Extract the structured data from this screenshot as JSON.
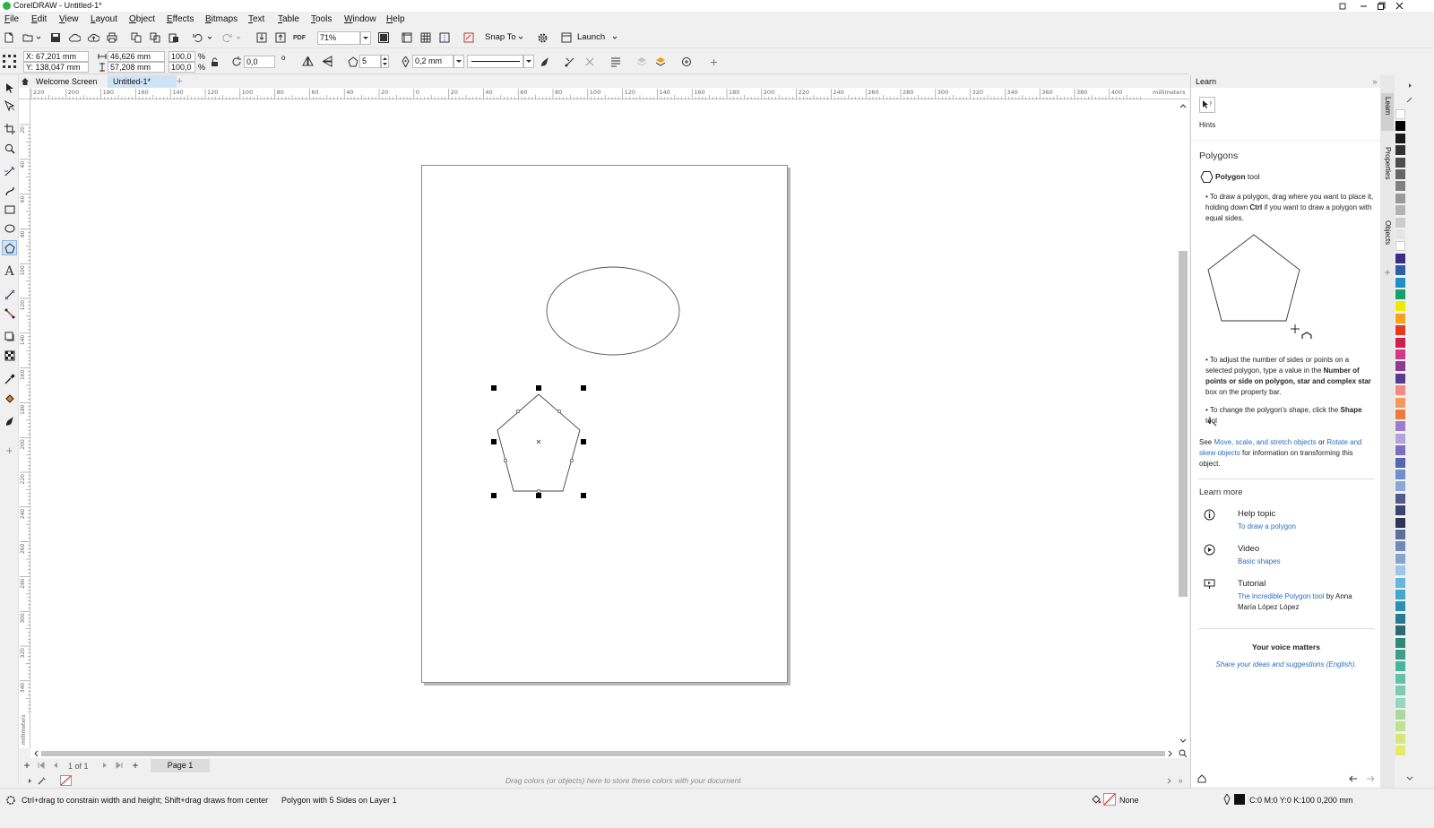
{
  "window": {
    "title": "CorelDRAW - Untitled-1*"
  },
  "menu": [
    "File",
    "Edit",
    "View",
    "Layout",
    "Object",
    "Effects",
    "Bitmaps",
    "Text",
    "Table",
    "Tools",
    "Window",
    "Help"
  ],
  "toolbar": {
    "zoom": "71%",
    "snap_to": "Snap To",
    "launch": "Launch"
  },
  "property_bar": {
    "x": "X: 67,201 mm",
    "y": "Y: 138,047 mm",
    "width": "46,626 mm",
    "height": "57,208 mm",
    "scale_x": "100,0",
    "scale_y": "100,0",
    "percent": "%",
    "rotation": "0,0",
    "degree": "o",
    "sides": "5",
    "outline_width": "0,2 mm"
  },
  "tabs": {
    "welcome": "Welcome Screen",
    "doc": "Untitled-1*",
    "add": "+"
  },
  "ruler": {
    "h_ticks": [
      "220",
      "200",
      "180",
      "160",
      "140",
      "120",
      "100",
      "80",
      "60",
      "40",
      "20",
      "0",
      "20",
      "40",
      "60",
      "80",
      "100",
      "120",
      "140",
      "160",
      "180",
      "200",
      "220",
      "240",
      "260",
      "280",
      "300",
      "320",
      "340",
      "360",
      "380",
      "400"
    ],
    "h_unit": "millimeters",
    "v_ticks": [
      "20",
      "40",
      "60",
      "80",
      "100",
      "120",
      "140",
      "160",
      "180",
      "200",
      "220",
      "240",
      "260",
      "280",
      "300",
      "320",
      "340"
    ],
    "v_unit": "millimeters"
  },
  "page_nav": {
    "count": "1 of 1",
    "page": "Page 1"
  },
  "palette_hint": "Drag colors (or objects) here to store these colors with your document",
  "status": {
    "hint": "Ctrl+drag to constrain width and height; Shift+drag draws from center",
    "selection": "Polygon with 5 Sides on Layer 1",
    "fill": "None",
    "outline": "C:0 M:0 Y:0 K:100  0,200 mm"
  },
  "learn": {
    "panel_title": "Learn",
    "hints_label": "Hints",
    "heading": "Polygons",
    "tool_name": "Polygon",
    "tool_suffix": "tool",
    "p1a": "To draw a polygon, drag where you want to place it, holding down",
    "p1b": "Ctrl",
    "p1c": "if you want to draw a polygon with equal sides.",
    "p2a": "To adjust the number of sides or points on a selected polygon, type a value in the",
    "p2b": "Number of points or side on polygon, star and complex star",
    "p2c": "box on the property bar.",
    "p3a": "To change the polygon's shape, click the",
    "p3b": "Shape",
    "p3c": "tool",
    "see": "See",
    "link1": "Move, scale, and stretch objects",
    "or": "or",
    "link2": "Rotate and skew objects",
    "see_end": "for information on transforming this object.",
    "learn_more": "Learn more",
    "help_title": "Help topic",
    "help_link": "To draw a polygon",
    "video_title": "Video",
    "video_link": "Basic shapes",
    "tut_title": "Tutorial",
    "tut_link": "The incredible Polygon tool",
    "tut_by": "by Anna María López López",
    "voice_title": "Your voice matters",
    "voice_link": "Share your ideas and suggestions (English)."
  },
  "dock_tabs": [
    "Learn",
    "Properties",
    "Objects"
  ],
  "colors": {
    "accent": "#2a6fbf",
    "selection_tab": "#cfe3f7"
  },
  "palette": [
    "#ffffff",
    "#000000",
    "#1a1a1a",
    "#333333",
    "#4d4d4d",
    "#666666",
    "#808080",
    "#999999",
    "#b3b3b3",
    "#cccccc",
    "#e6e6e6",
    "#ffffff",
    "#3a2d8a",
    "#2e5ea8",
    "#1f8fc6",
    "#16a06a",
    "#f2e800",
    "#f7a21b",
    "#e63a1c",
    "#cf1d4e",
    "#d23a86",
    "#8d3a8f",
    "#5a3b93",
    "#f18a82",
    "#f59a5a",
    "#ef7a3b",
    "#9a7bcc",
    "#b3a2dc",
    "#7c6fbd",
    "#5565b0",
    "#6f8fcc",
    "#8aa7d8",
    "#4f5b8a",
    "#3b466d",
    "#2c3656",
    "#5b6f9e",
    "#6d8ab8",
    "#87a4cf",
    "#9fc6e8",
    "#64b7dc",
    "#3fa9cf",
    "#2c8fb6",
    "#2a7a94",
    "#2d6b6e",
    "#2f8a7b",
    "#3aa08a",
    "#49b49c",
    "#64c0a6",
    "#7ccdb2",
    "#96d8bf",
    "#a9dba0",
    "#bfe28e",
    "#d6e87b",
    "#e3ea6c"
  ]
}
